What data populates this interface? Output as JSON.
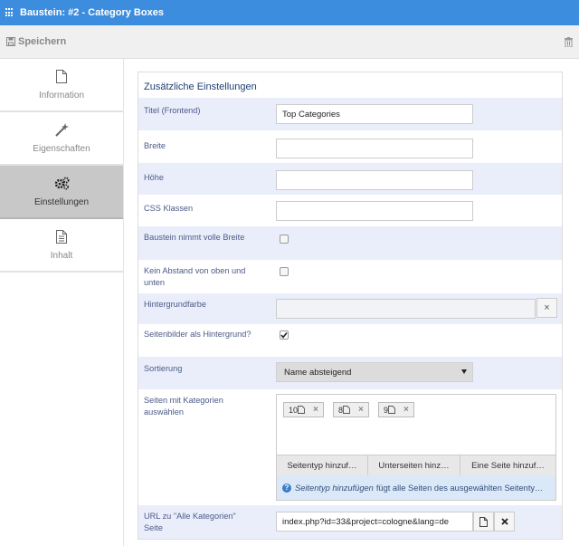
{
  "window": {
    "title": "Baustein: #2 - Category Boxes"
  },
  "toolbar": {
    "save_label": "Speichern"
  },
  "sidebar": {
    "tabs": [
      {
        "label": "Information",
        "icon": "file-icon"
      },
      {
        "label": "Eigenschaften",
        "icon": "magic-wand-icon"
      },
      {
        "label": "Einstellungen",
        "icon": "gears-icon",
        "active": true
      },
      {
        "label": "Inhalt",
        "icon": "file-text-icon"
      }
    ]
  },
  "panel": {
    "title": "Zusätzliche Einstellungen",
    "fields": {
      "title_frontend": {
        "label": "Titel (Frontend)",
        "value": "Top Categories"
      },
      "width": {
        "label": "Breite",
        "value": ""
      },
      "height": {
        "label": "Höhe",
        "value": ""
      },
      "css_classes": {
        "label": "CSS Klassen",
        "value": ""
      },
      "full_width": {
        "label": "Baustein nimmt volle Breite",
        "checked": false
      },
      "no_spacing": {
        "label": "Kein Abstand von oben und unten",
        "checked": false
      },
      "bg_color": {
        "label": "Hintergrundfarbe",
        "clear": "×"
      },
      "page_images_bg": {
        "label": "Seitenbilder als Hintergrund?",
        "checked": true
      },
      "sorting": {
        "label": "Sortierung",
        "value": "Name absteigend"
      },
      "pages": {
        "label": "Seiten mit Kategorien auswählen",
        "chips": [
          "10",
          "8",
          "9"
        ],
        "buttons": [
          "Seitentyp hinzuf…",
          "Unterseiten hinz…",
          "Eine Seite hinzuf…"
        ],
        "info_italic": "Seitentyp hinzufügen",
        "info_text": "fügt alle Seiten des ausgewählten Seitenty…"
      },
      "all_categories_url": {
        "label": "URL zu \"Alle Kategorien\" Seite",
        "value": "index.php?id=33&project=cologne&lang=de"
      }
    }
  },
  "colors": {
    "titlebar": "#3c8dde",
    "row_shade": "#eaeefb",
    "info_bg": "#dbe8f8"
  }
}
